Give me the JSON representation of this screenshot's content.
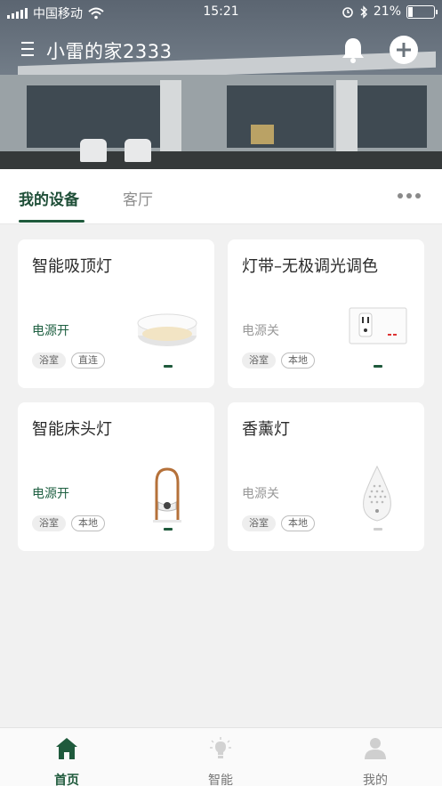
{
  "status_bar": {
    "carrier": "中国移动",
    "time": "15:21",
    "battery_percent": "21%",
    "battery_level": 0.21
  },
  "header": {
    "home_name": "小雷的家2333"
  },
  "tabs": [
    {
      "label": "我的设备",
      "active": true
    },
    {
      "label": "客厅",
      "active": false
    }
  ],
  "devices": [
    {
      "name": "智能吸顶灯",
      "power": "电源开",
      "tags": [
        "浴室",
        "直连"
      ],
      "on": true,
      "icon": "ceiling-light"
    },
    {
      "name": "灯带–无极调光调色",
      "power": "电源关",
      "tags": [
        "浴室",
        "本地"
      ],
      "on": false,
      "icon": "wall-outlet"
    },
    {
      "name": "智能床头灯",
      "power": "电源开",
      "tags": [
        "浴室",
        "本地"
      ],
      "on": true,
      "icon": "bedside-lamp"
    },
    {
      "name": "香薰灯",
      "power": "电源关",
      "tags": [
        "浴室",
        "本地"
      ],
      "on": false,
      "icon": "aroma-diffuser"
    }
  ],
  "bottom_nav": [
    {
      "label": "首页",
      "active": true,
      "icon": "home-icon"
    },
    {
      "label": "智能",
      "active": false,
      "icon": "bulb-icon"
    },
    {
      "label": "我的",
      "active": false,
      "icon": "user-icon"
    }
  ],
  "colors": {
    "accent": "#1f5a3c",
    "power_on": "#1f6042",
    "power_off": "#999999"
  }
}
